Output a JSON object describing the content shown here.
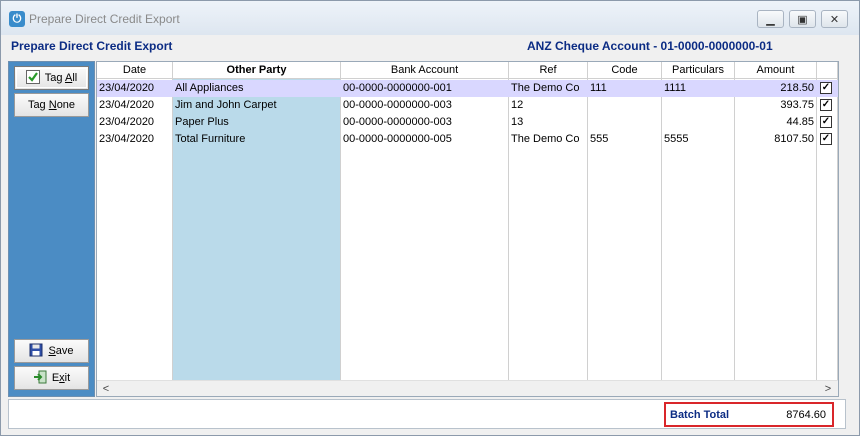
{
  "window": {
    "title": "Prepare Direct Credit Export",
    "icon": "power-icon"
  },
  "header": {
    "form_title": "Prepare Direct Credit Export",
    "account": "ANZ Cheque Account - 01-0000-0000000-01"
  },
  "sidebar": {
    "tag_all": {
      "prefix": "Tag ",
      "key": "A",
      "suffix": "ll"
    },
    "tag_none": {
      "prefix": "Tag ",
      "key": "N",
      "suffix": "one"
    },
    "save": {
      "key": "S",
      "suffix": "ave"
    },
    "exit": {
      "prefix": "E",
      "key": "x",
      "suffix": "it"
    }
  },
  "columns": [
    "Date",
    "Other Party",
    "Bank Account",
    "Ref",
    "Code",
    "Particulars",
    "Amount"
  ],
  "rows": [
    {
      "date": "23/04/2020",
      "party": "All Appliances",
      "bank": "00-0000-0000000-001",
      "ref": "The Demo Co",
      "code": "111",
      "particulars": "1111",
      "amount": "218.50",
      "checked": true
    },
    {
      "date": "23/04/2020",
      "party": "Jim and John Carpet",
      "bank": "00-0000-0000000-003",
      "ref": "12",
      "code": "",
      "particulars": "",
      "amount": "393.75",
      "checked": true
    },
    {
      "date": "23/04/2020",
      "party": "Paper Plus",
      "bank": "00-0000-0000000-003",
      "ref": "13",
      "code": "",
      "particulars": "",
      "amount": "44.85",
      "checked": true
    },
    {
      "date": "23/04/2020",
      "party": "Total Furniture",
      "bank": "00-0000-0000000-005",
      "ref": "The Demo Co",
      "code": "555",
      "particulars": "5555",
      "amount": "8107.50",
      "checked": true
    }
  ],
  "footer": {
    "batch_total_label": "Batch Total",
    "batch_total_value": "8764.60"
  },
  "colors": {
    "sidebar": "#4b8cc4",
    "heading": "#0c2c84",
    "selected_row": "#d9d7ff",
    "other_party_column": "#badaea",
    "batch_border": "#d9262a"
  }
}
